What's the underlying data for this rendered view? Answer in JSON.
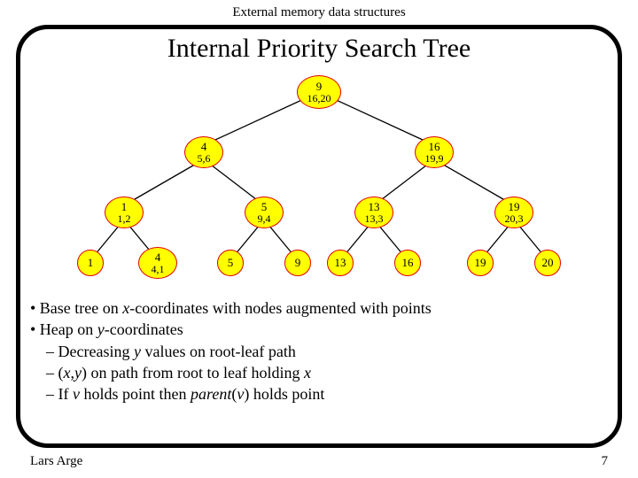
{
  "header": "External memory data structures",
  "title": "Internal Priority Search Tree",
  "footer": {
    "author": "Lars Arge",
    "page": "7"
  },
  "bullets": {
    "b1_pre": "• Base tree on ",
    "b1_it": "x",
    "b1_post": "-coordinates with nodes augmented with points",
    "b2_pre": "• Heap on ",
    "b2_it": "y",
    "b2_post": "-coordinates",
    "b3_pre": "    – Decreasing ",
    "b3_it": "y",
    "b3_post": " values on root-leaf path",
    "b4_pre": "    – (",
    "b4_x": "x",
    "b4_c1": ",",
    "b4_y": "y",
    "b4_mid": ") on path from root to leaf holding ",
    "b4_x2": "x",
    "b5_pre": "    – If ",
    "b5_v": "v",
    "b5_mid": " holds point then ",
    "b5_par": "parent",
    "b5_open": "(",
    "b5_v2": "v",
    "b5_post": ") holds point"
  },
  "tree": {
    "root": {
      "k": "9",
      "p": "16,20"
    },
    "n_l": {
      "k": "4",
      "p": "5,6"
    },
    "n_r": {
      "k": "16",
      "p": "19,9"
    },
    "n_ll": {
      "k": "1",
      "p": "1,2"
    },
    "n_lr": {
      "k": "5",
      "p": "9,4"
    },
    "n_rl": {
      "k": "13",
      "p": "13,3"
    },
    "n_rr": {
      "k": "19",
      "p": "20,3"
    },
    "leaf1": {
      "k": "1"
    },
    "leaf2": {
      "k": "4",
      "p": "4,1"
    },
    "leaf3": {
      "k": "5"
    },
    "leaf4": {
      "k": "9"
    },
    "leaf5": {
      "k": "13"
    },
    "leaf6": {
      "k": "16"
    },
    "leaf7": {
      "k": "19"
    },
    "leaf8": {
      "k": "20"
    }
  },
  "chart_data": {
    "type": "tree",
    "title": "Internal Priority Search Tree",
    "nodes": [
      {
        "id": "root",
        "key": 9,
        "point": [
          16,
          20
        ],
        "parent": null
      },
      {
        "id": "n_l",
        "key": 4,
        "point": [
          5,
          6
        ],
        "parent": "root"
      },
      {
        "id": "n_r",
        "key": 16,
        "point": [
          19,
          9
        ],
        "parent": "root"
      },
      {
        "id": "n_ll",
        "key": 1,
        "point": [
          1,
          2
        ],
        "parent": "n_l"
      },
      {
        "id": "n_lr",
        "key": 5,
        "point": [
          9,
          4
        ],
        "parent": "n_l"
      },
      {
        "id": "n_rl",
        "key": 13,
        "point": [
          13,
          3
        ],
        "parent": "n_r"
      },
      {
        "id": "n_rr",
        "key": 19,
        "point": [
          20,
          3
        ],
        "parent": "n_r"
      },
      {
        "id": "leaf1",
        "key": 1,
        "point": null,
        "parent": "n_ll"
      },
      {
        "id": "leaf2",
        "key": 4,
        "point": [
          4,
          1
        ],
        "parent": "n_ll"
      },
      {
        "id": "leaf3",
        "key": 5,
        "point": null,
        "parent": "n_lr"
      },
      {
        "id": "leaf4",
        "key": 9,
        "point": null,
        "parent": "n_lr"
      },
      {
        "id": "leaf5",
        "key": 13,
        "point": null,
        "parent": "n_rl"
      },
      {
        "id": "leaf6",
        "key": 16,
        "point": null,
        "parent": "n_rl"
      },
      {
        "id": "leaf7",
        "key": 19,
        "point": null,
        "parent": "n_rr"
      },
      {
        "id": "leaf8",
        "key": 20,
        "point": null,
        "parent": "n_rr"
      }
    ]
  }
}
